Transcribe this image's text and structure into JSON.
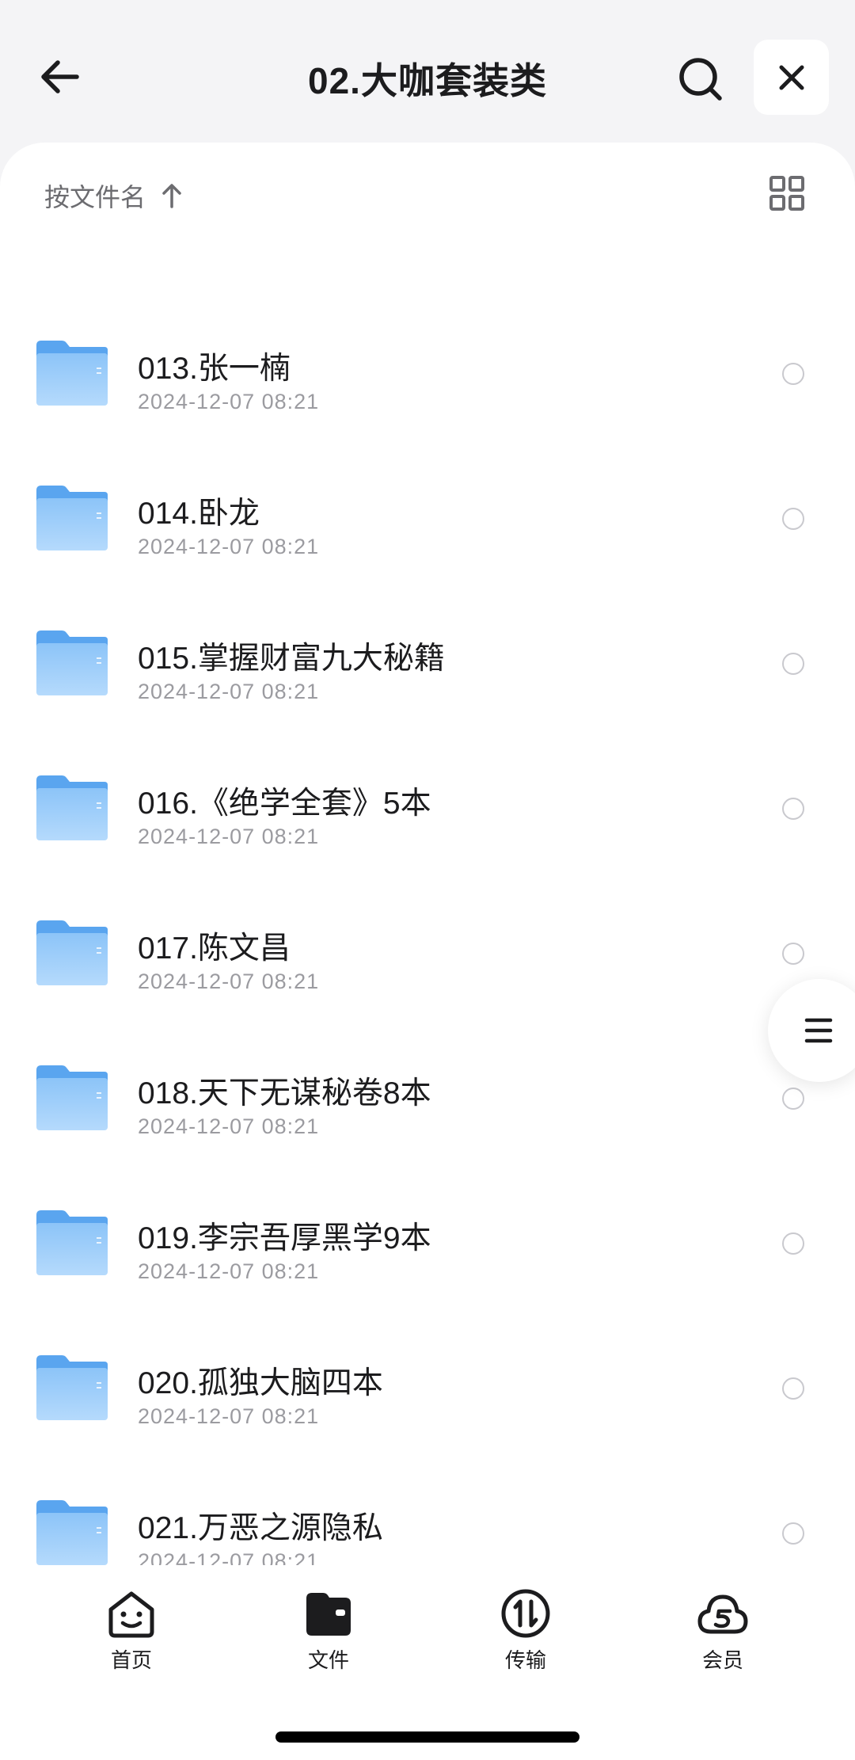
{
  "header": {
    "title": "02.大咖套装类"
  },
  "sort": {
    "label": "按文件名"
  },
  "files": [
    {
      "name": "013.张一楠",
      "date": "2024-12-07 08:21"
    },
    {
      "name": "014.卧龙",
      "date": "2024-12-07 08:21"
    },
    {
      "name": "015.掌握财富九大秘籍",
      "date": "2024-12-07 08:21"
    },
    {
      "name": "016.《绝学全套》5本",
      "date": "2024-12-07 08:21"
    },
    {
      "name": "017.陈文昌",
      "date": "2024-12-07 08:21"
    },
    {
      "name": "018.天下无谋秘卷8本",
      "date": "2024-12-07 08:21"
    },
    {
      "name": "019.李宗吾厚黑学9本",
      "date": "2024-12-07 08:21"
    },
    {
      "name": "020.孤独大脑四本",
      "date": "2024-12-07 08:21"
    },
    {
      "name": "021.万恶之源隐私",
      "date": "2024-12-07 08:21"
    }
  ],
  "tabs": [
    {
      "label": "首页",
      "icon": "home-face-icon"
    },
    {
      "label": "文件",
      "icon": "files-icon"
    },
    {
      "label": "传输",
      "icon": "transfer-icon"
    },
    {
      "label": "会员",
      "icon": "member-cloud-icon"
    }
  ],
  "colors": {
    "folder": "#7cb8f5",
    "background": "#f4f4f6",
    "date_text": "#9b9ba0"
  }
}
